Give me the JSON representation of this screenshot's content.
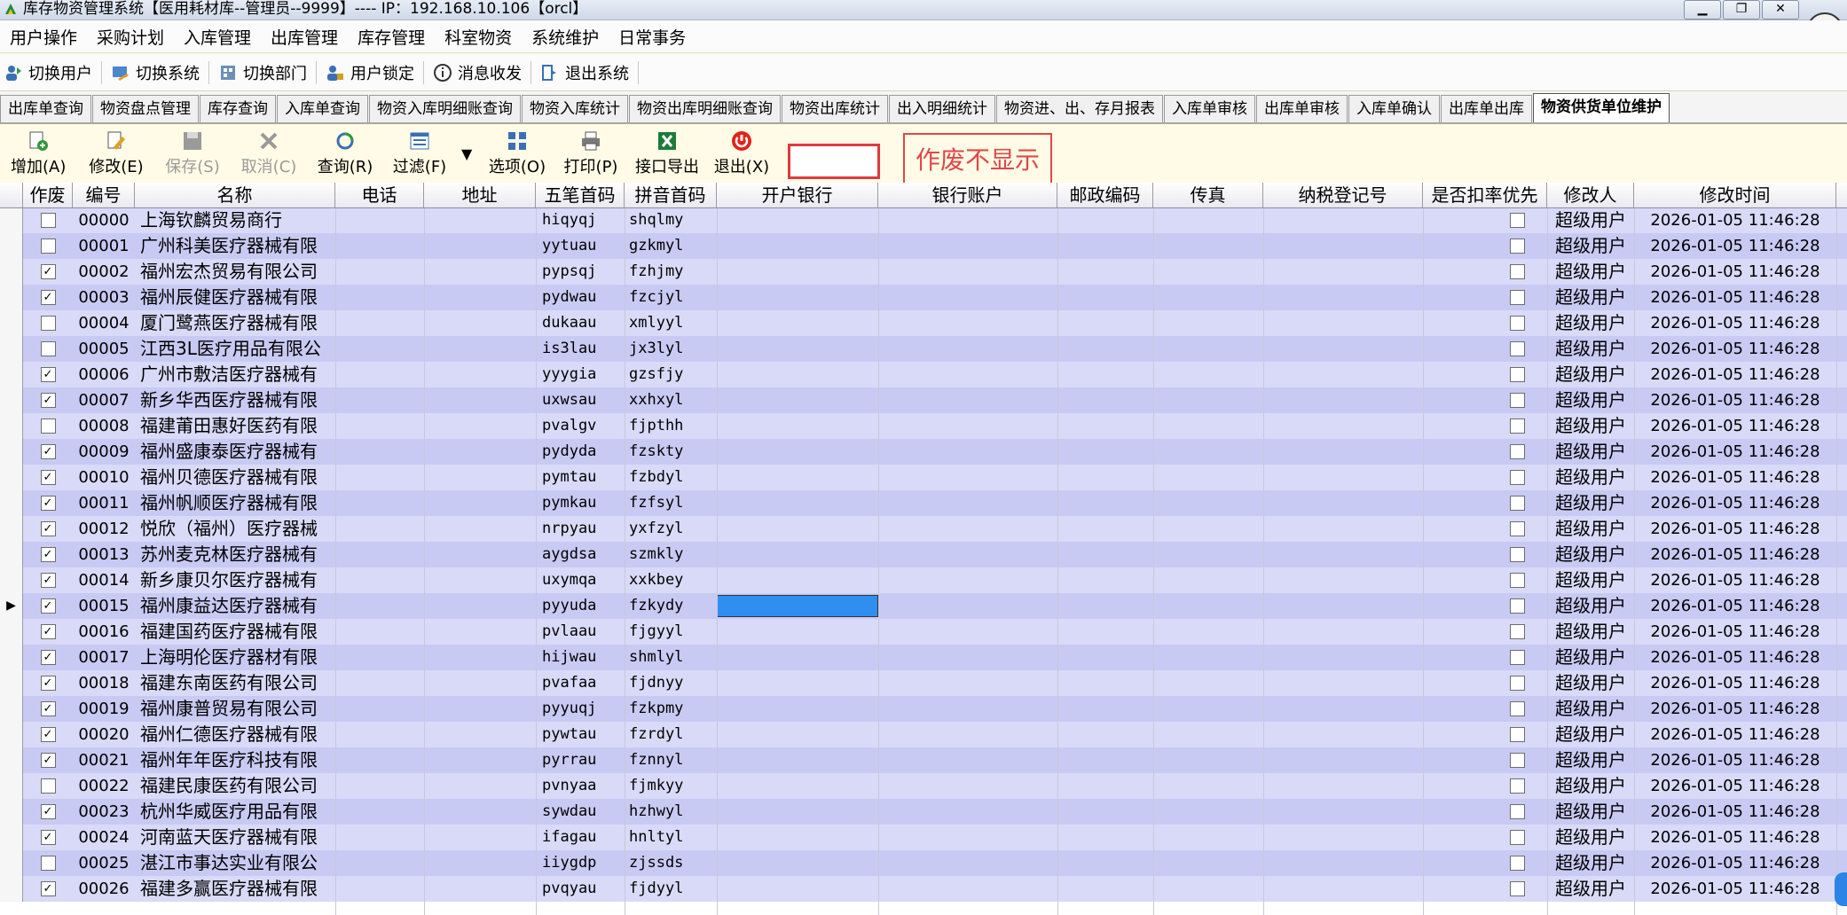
{
  "window": {
    "title": "库存物资管理系统【医用耗材库--管理员--9999】---- IP：192.168.10.106【orcl】",
    "buttons": [
      "▁",
      "❐",
      "✕"
    ]
  },
  "menubar": [
    "用户操作",
    "采购计划",
    "入库管理",
    "出库管理",
    "库存管理",
    "科室物资",
    "系统维护",
    "日常事务"
  ],
  "toolbar1": [
    {
      "label": "切换用户",
      "icon": "switch-user-icon"
    },
    {
      "label": "切换系统",
      "icon": "switch-system-icon"
    },
    {
      "label": "切换部门",
      "icon": "switch-dept-icon"
    },
    {
      "label": "用户锁定",
      "icon": "user-lock-icon"
    },
    {
      "label": "消息收发",
      "icon": "message-icon"
    },
    {
      "label": "退出系统",
      "icon": "exit-system-icon"
    }
  ],
  "tabs": [
    "出库单查询",
    "物资盘点管理",
    "库存查询",
    "入库单查询",
    "物资入库明细账查询",
    "物资入库统计",
    "物资出库明细账查询",
    "物资出库统计",
    "出入明细统计",
    "物资进、出、存月报表",
    "入库单审核",
    "出库单审核",
    "入库单确认",
    "出库单出库",
    "物资供货单位维护"
  ],
  "active_tab": "物资供货单位维护",
  "toolbar2": {
    "add": "增加(A)",
    "edit": "修改(E)",
    "save": "保存(S)",
    "cancel": "取消(C)",
    "query": "查询(R)",
    "filter": "过滤(F)",
    "options": "选项(O)",
    "print": "打印(P)",
    "export": "接口导出",
    "exit": "退出(X)"
  },
  "annotation": "作废不显示",
  "columns": [
    "作废",
    "编号",
    "名称",
    "电话",
    "地址",
    "五笔首码",
    "拼音首码",
    "开户银行",
    "银行账户",
    "邮政编码",
    "传真",
    "纳税登记号",
    "是否扣率优先",
    "修改人",
    "修改时间"
  ],
  "rows": [
    {
      "void": false,
      "code": "00000",
      "name": "上海钦麟贸易商行",
      "wubi": "hiqyqj",
      "pinyin": "shqlmy",
      "modifier": "超级用户",
      "time": "2026-01-05 11:46:28"
    },
    {
      "void": false,
      "code": "00001",
      "name": "广州科美医疗器械有限",
      "wubi": "yytuau",
      "pinyin": "gzkmyl",
      "modifier": "超级用户",
      "time": "2026-01-05 11:46:28"
    },
    {
      "void": true,
      "code": "00002",
      "name": "福州宏杰贸易有限公司",
      "wubi": "pypsqj",
      "pinyin": "fzhjmy",
      "modifier": "超级用户",
      "time": "2026-01-05 11:46:28"
    },
    {
      "void": true,
      "code": "00003",
      "name": "福州辰健医疗器械有限",
      "wubi": "pydwau",
      "pinyin": "fzcjyl",
      "modifier": "超级用户",
      "time": "2026-01-05 11:46:28"
    },
    {
      "void": false,
      "code": "00004",
      "name": "厦门鹭燕医疗器械有限",
      "wubi": "dukaau",
      "pinyin": "xmlyyl",
      "modifier": "超级用户",
      "time": "2026-01-05 11:46:28"
    },
    {
      "void": false,
      "code": "00005",
      "name": "江西3L医疗用品有限公",
      "wubi": "is3lau",
      "pinyin": "jx3lyl",
      "modifier": "超级用户",
      "time": "2026-01-05 11:46:28"
    },
    {
      "void": true,
      "code": "00006",
      "name": "广州市敷洁医疗器械有",
      "wubi": "yyygia",
      "pinyin": "gzsfjy",
      "modifier": "超级用户",
      "time": "2026-01-05 11:46:28"
    },
    {
      "void": true,
      "code": "00007",
      "name": "新乡华西医疗器械有限",
      "wubi": "uxwsau",
      "pinyin": "xxhxyl",
      "modifier": "超级用户",
      "time": "2026-01-05 11:46:28"
    },
    {
      "void": false,
      "code": "00008",
      "name": "福建莆田惠好医药有限",
      "wubi": "pvalgv",
      "pinyin": "fjpthh",
      "modifier": "超级用户",
      "time": "2026-01-05 11:46:28"
    },
    {
      "void": true,
      "code": "00009",
      "name": "福州盛康泰医疗器械有",
      "wubi": "pydyda",
      "pinyin": "fzskty",
      "modifier": "超级用户",
      "time": "2026-01-05 11:46:28"
    },
    {
      "void": true,
      "code": "00010",
      "name": "福州贝德医疗器械有限",
      "wubi": "pymtau",
      "pinyin": "fzbdyl",
      "modifier": "超级用户",
      "time": "2026-01-05 11:46:28"
    },
    {
      "void": true,
      "code": "00011",
      "name": "福州帆顺医疗器械有限",
      "wubi": "pymkau",
      "pinyin": "fzfsyl",
      "modifier": "超级用户",
      "time": "2026-01-05 11:46:28"
    },
    {
      "void": true,
      "code": "00012",
      "name": "悦欣（福州）医疗器械",
      "wubi": "nrpyau",
      "pinyin": "yxfzyl",
      "modifier": "超级用户",
      "time": "2026-01-05 11:46:28"
    },
    {
      "void": true,
      "code": "00013",
      "name": "苏州麦克林医疗器械有",
      "wubi": "aygdsa",
      "pinyin": "szmkly",
      "modifier": "超级用户",
      "time": "2026-01-05 11:46:28"
    },
    {
      "void": true,
      "code": "00014",
      "name": "新乡康贝尔医疗器械有",
      "wubi": "uxymqa",
      "pinyin": "xxkbey",
      "modifier": "超级用户",
      "time": "2026-01-05 11:46:28"
    },
    {
      "void": true,
      "code": "00015",
      "name": "福州康益达医疗器械有",
      "wubi": "pyyuda",
      "pinyin": "fzkydy",
      "modifier": "超级用户",
      "time": "2026-01-05 11:46:28",
      "selected": true
    },
    {
      "void": true,
      "code": "00016",
      "name": "福建国药医疗器械有限",
      "wubi": "pvlaau",
      "pinyin": "fjgyyl",
      "modifier": "超级用户",
      "time": "2026-01-05 11:46:28"
    },
    {
      "void": true,
      "code": "00017",
      "name": "上海明伦医疗器材有限",
      "wubi": "hijwau",
      "pinyin": "shmlyl",
      "modifier": "超级用户",
      "time": "2026-01-05 11:46:28"
    },
    {
      "void": true,
      "code": "00018",
      "name": "福建东南医药有限公司",
      "wubi": "pvafaa",
      "pinyin": "fjdnyy",
      "modifier": "超级用户",
      "time": "2026-01-05 11:46:28"
    },
    {
      "void": true,
      "code": "00019",
      "name": "福州康普贸易有限公司",
      "wubi": "pyyuqj",
      "pinyin": "fzkpmy",
      "modifier": "超级用户",
      "time": "2026-01-05 11:46:28"
    },
    {
      "void": true,
      "code": "00020",
      "name": "福州仁德医疗器械有限",
      "wubi": "pywtau",
      "pinyin": "fzrdyl",
      "modifier": "超级用户",
      "time": "2026-01-05 11:46:28"
    },
    {
      "void": true,
      "code": "00021",
      "name": "福州年年医疗科技有限",
      "wubi": "pyrrau",
      "pinyin": "fznnyl",
      "modifier": "超级用户",
      "time": "2026-01-05 11:46:28"
    },
    {
      "void": false,
      "code": "00022",
      "name": "福建民康医药有限公司",
      "wubi": "pvnyaa",
      "pinyin": "fjmkyy",
      "modifier": "超级用户",
      "time": "2026-01-05 11:46:28"
    },
    {
      "void": true,
      "code": "00023",
      "name": "杭州华威医疗用品有限",
      "wubi": "sywdau",
      "pinyin": "hzhwyl",
      "modifier": "超级用户",
      "time": "2026-01-05 11:46:28"
    },
    {
      "void": true,
      "code": "00024",
      "name": "河南蓝天医疗器械有限",
      "wubi": "ifagau",
      "pinyin": "hnltyl",
      "modifier": "超级用户",
      "time": "2026-01-05 11:46:28"
    },
    {
      "void": false,
      "code": "00025",
      "name": "湛江市事达实业有限公",
      "wubi": "iiygdp",
      "pinyin": "zjssds",
      "modifier": "超级用户",
      "time": "2026-01-05 11:46:28"
    },
    {
      "void": true,
      "code": "00026",
      "name": "福建多赢医疗器械有限",
      "wubi": "pvqyau",
      "pinyin": "fjdyyl",
      "modifier": "超级用户",
      "time": "2026-01-05 11:46:28"
    }
  ],
  "colors": {
    "row_odd": "#d9daf8",
    "row_even": "#c9caf3",
    "selection": "#2f8ef0",
    "annotation": "#e04848"
  }
}
